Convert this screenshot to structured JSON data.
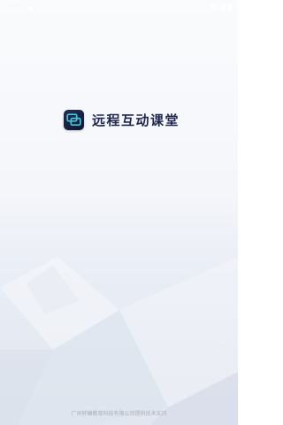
{
  "status_bar": {
    "time": "12:34",
    "icons": [
      "notification-icon",
      "wifi-icon",
      "signal-icon",
      "battery-icon"
    ]
  },
  "splash": {
    "app_name": "远程互动课堂",
    "logo_icon": "classroom-logo-icon"
  },
  "footer": {
    "text": "广州轩辕教育科技有限公司提供技术支持"
  },
  "colors": {
    "brand_dark": "#1f2750",
    "icon_bg": "#161e3f",
    "icon_accent": "#3fc6d7",
    "footer_text": "#a7aebb"
  }
}
